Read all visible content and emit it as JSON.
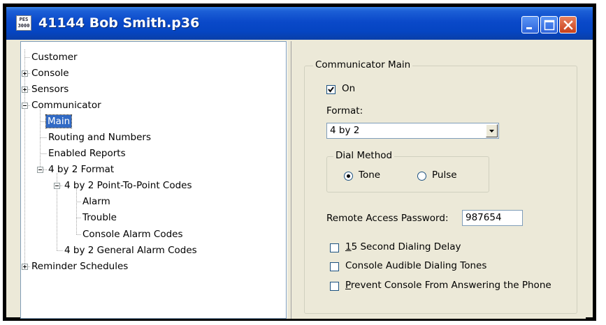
{
  "window": {
    "title": "41144 Bob Smith.p36",
    "app_icon_text": "PES 3000",
    "buttons": [
      "minimize",
      "maximize",
      "close"
    ]
  },
  "tree": {
    "items": [
      {
        "label": "Customer",
        "level": 0,
        "expander": "none",
        "selected": false
      },
      {
        "label": "Console",
        "level": 0,
        "expander": "plus",
        "selected": false
      },
      {
        "label": "Sensors",
        "level": 0,
        "expander": "plus",
        "selected": false
      },
      {
        "label": "Communicator",
        "level": 0,
        "expander": "minus",
        "selected": false
      },
      {
        "label": "Main",
        "level": 1,
        "expander": "none",
        "selected": true
      },
      {
        "label": "Routing and Numbers",
        "level": 1,
        "expander": "none",
        "selected": false
      },
      {
        "label": "Enabled Reports",
        "level": 1,
        "expander": "none",
        "selected": false
      },
      {
        "label": "4 by 2 Format",
        "level": 1,
        "expander": "minus",
        "selected": false
      },
      {
        "label": "4 by 2 Point-To-Point Codes",
        "level": 2,
        "expander": "minus",
        "selected": false
      },
      {
        "label": "Alarm",
        "level": 3,
        "expander": "none",
        "selected": false
      },
      {
        "label": "Trouble",
        "level": 3,
        "expander": "none",
        "selected": false
      },
      {
        "label": "Console Alarm Codes",
        "level": 3,
        "expander": "none",
        "selected": false
      },
      {
        "label": "4 by 2 General Alarm Codes",
        "level": 2,
        "expander": "none",
        "selected": false
      },
      {
        "label": "Reminder Schedules",
        "level": 0,
        "expander": "plus",
        "selected": false
      }
    ]
  },
  "panel": {
    "group_title": "Communicator Main",
    "on": {
      "label": "On",
      "checked": true
    },
    "format_label": "Format:",
    "format_value": "4 by 2",
    "dial_method": {
      "title": "Dial Method",
      "options": [
        {
          "label": "Tone",
          "selected": true
        },
        {
          "label": "Pulse",
          "selected": false
        }
      ]
    },
    "password_label": "Remote Access Password:",
    "password_value": "987654",
    "options": [
      {
        "mnemonic": "1",
        "rest": "5 Second Dialing Delay",
        "checked": false
      },
      {
        "mnemonic": "",
        "rest": "Console Audible Dialing Tones",
        "checked": false
      },
      {
        "mnemonic": "P",
        "rest": "revent Console From Answering the Phone",
        "checked": false
      }
    ]
  },
  "colors": {
    "titlebar": "#0a49c9",
    "selection": "#316ac5",
    "window_face": "#ece9d8",
    "close_button": "#c8401a"
  }
}
